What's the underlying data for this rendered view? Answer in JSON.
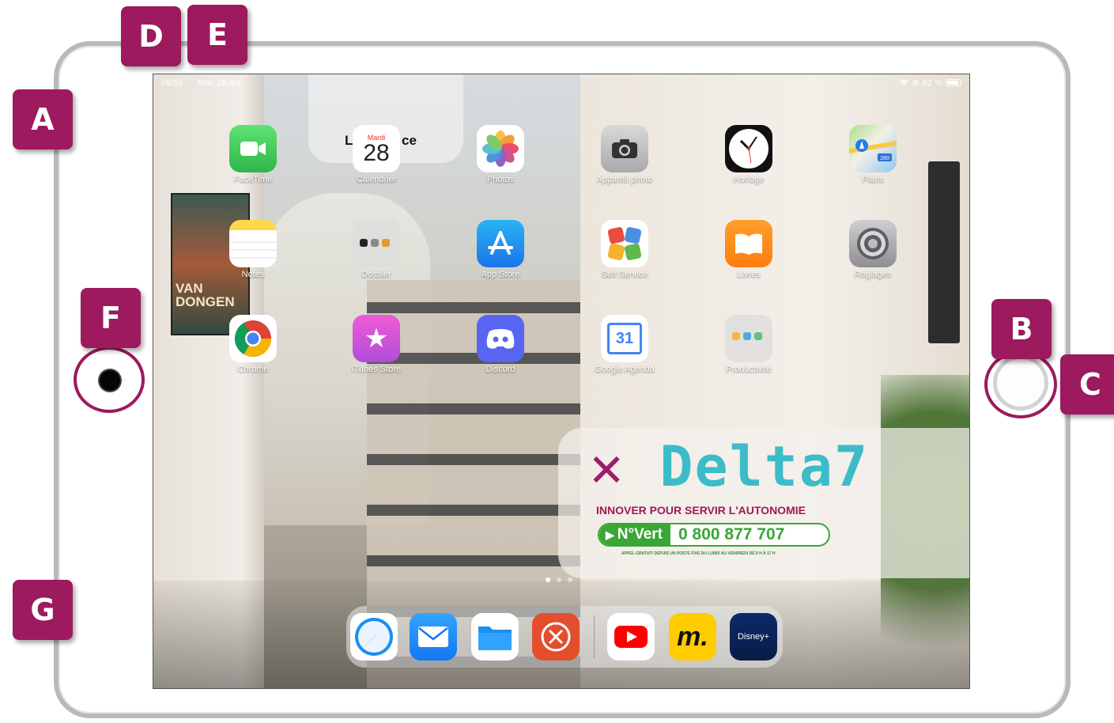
{
  "status_bar": {
    "time": "09:55",
    "date": "Mar. 28 avr.",
    "battery": "82 %"
  },
  "widget_top": {
    "partial_text": "L",
    "partial_text2": "ce"
  },
  "apps": [
    {
      "label": "FaceTime",
      "icon": "facetime-icon"
    },
    {
      "label": "Calendrier",
      "icon": "calendar-icon",
      "month": "Mardi",
      "day": "28"
    },
    {
      "label": "Photos",
      "icon": "photos-icon"
    },
    {
      "label": "Appareil photo",
      "icon": "camera-icon"
    },
    {
      "label": "Horloge",
      "icon": "clock-icon"
    },
    {
      "label": "Plans",
      "icon": "maps-icon",
      "badge": "280"
    },
    {
      "label": "Notes",
      "icon": "notes-icon"
    },
    {
      "label": "Dossier",
      "icon": "folder-icon"
    },
    {
      "label": "App Store",
      "icon": "appstore-icon"
    },
    {
      "label": "Self Service",
      "icon": "self-service-icon"
    },
    {
      "label": "Livres",
      "icon": "books-icon"
    },
    {
      "label": "Réglages",
      "icon": "settings-icon"
    },
    {
      "label": "Chrome",
      "icon": "chrome-icon"
    },
    {
      "label": "iTunes Store",
      "icon": "itunes-icon"
    },
    {
      "label": "Discord",
      "icon": "discord-icon"
    },
    {
      "label": "Google Agenda",
      "icon": "google-calendar-icon",
      "day": "31"
    },
    {
      "label": "Productivité",
      "icon": "productivity-folder-icon"
    }
  ],
  "ad_widget": {
    "brand": "Delta",
    "brand_suffix": "7",
    "tagline": "INNOVER POUR SERVIR L'AUTONOMIE",
    "phone_label": "N°Vert",
    "phone_number": "0 800 877 707",
    "fine_print": "APPEL GRATUIT DEPUIS UN POSTE FIXE DU LUNDI AU VENDREDI DE 9 H À 17 H"
  },
  "wallpaper": {
    "poster_text": "VAN DONGEN"
  },
  "dock": {
    "apps": [
      {
        "name": "safari",
        "icon": "safari-icon"
      },
      {
        "name": "mail",
        "icon": "mail-icon"
      },
      {
        "name": "files",
        "icon": "files-icon"
      },
      {
        "name": "remote-desktop",
        "icon": "remote-desktop-icon"
      },
      {
        "name": "youtube",
        "icon": "youtube-icon"
      },
      {
        "name": "m",
        "icon": "m-app-icon",
        "text": "m."
      },
      {
        "name": "disney-plus",
        "icon": "disney-plus-icon",
        "text": "Disney+"
      }
    ]
  },
  "page_dots": {
    "count": 3,
    "active": 0
  },
  "callouts": [
    "A",
    "B",
    "C",
    "D",
    "E",
    "F",
    "G"
  ],
  "colors": {
    "callout": "#9c1a5d",
    "frame": "#b9b9b9",
    "delta_teal": "#3cbcc8",
    "delta_green": "#3aa635"
  }
}
